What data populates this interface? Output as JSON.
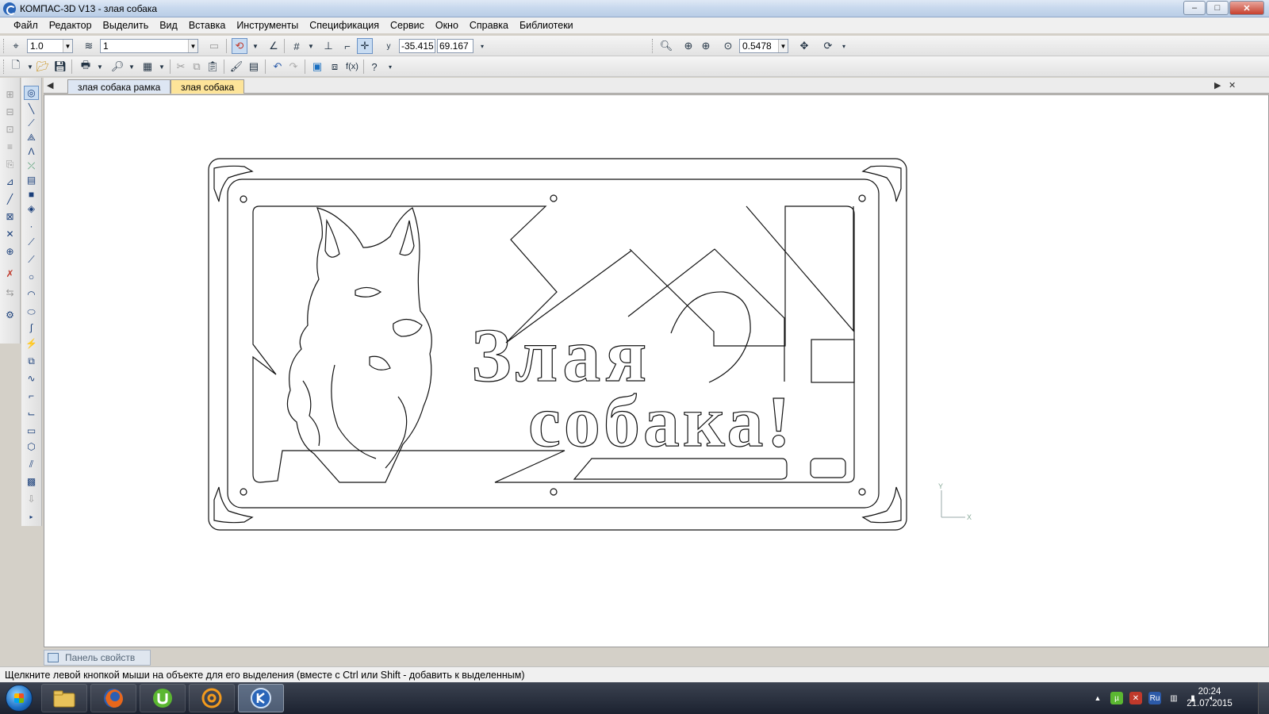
{
  "window": {
    "title": "КОМПАС-3D V13 - злая собака",
    "min": "–",
    "max": "□",
    "close": "✕"
  },
  "menu": [
    {
      "label": "Файл"
    },
    {
      "label": "Редактор"
    },
    {
      "label": "Выделить"
    },
    {
      "label": "Вид"
    },
    {
      "label": "Вставка"
    },
    {
      "label": "Инструменты"
    },
    {
      "label": "Спецификация"
    },
    {
      "label": "Сервис"
    },
    {
      "label": "Окно"
    },
    {
      "label": "Справка"
    },
    {
      "label": "Библиотеки"
    }
  ],
  "toolbar": {
    "step_value": "1.0",
    "layer_value": "1",
    "coord_x": "-35.415",
    "coord_y": "69.167",
    "zoom_value": "0.5478"
  },
  "tabs": [
    {
      "label": "злая собака рамка"
    },
    {
      "label": "злая собака"
    }
  ],
  "properties_panel": {
    "label": "Панель свойств"
  },
  "status": {
    "text": "Щелкните левой кнопкой мыши на объекте для его выделения (вместе с Ctrl или Shift - добавить к выделенным)"
  },
  "drawing": {
    "word1": "Злая",
    "word2": "собака!",
    "axis_x": "X",
    "axis_y": "Y"
  },
  "taskbar": {
    "clock_time": "20:24",
    "clock_date": "21.07.2015",
    "lang": "Ru"
  },
  "colors": {
    "active_tab": "#fde499",
    "accent": "#2a65b8"
  }
}
